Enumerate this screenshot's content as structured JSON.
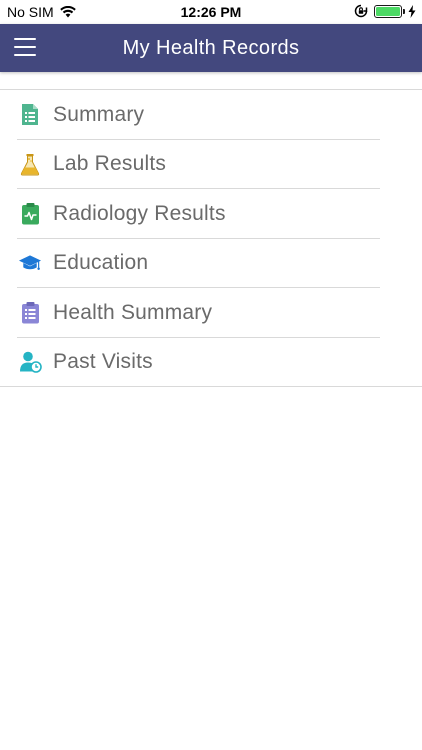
{
  "status": {
    "carrier": "No SIM",
    "time": "12:26 PM",
    "battery_color": "#4cd964"
  },
  "header": {
    "title": "My Health Records",
    "background": "#43487e"
  },
  "menu": {
    "items": [
      {
        "label": "Summary",
        "icon": "document-icon",
        "color": "#4fb58f"
      },
      {
        "label": "Lab Results",
        "icon": "flask-icon",
        "color": "#e8b52c"
      },
      {
        "label": "Radiology Results",
        "icon": "clipboard-pulse-icon",
        "color": "#3aaa5d"
      },
      {
        "label": "Education",
        "icon": "graduation-cap-icon",
        "color": "#1e78d6"
      },
      {
        "label": "Health Summary",
        "icon": "clipboard-list-icon",
        "color": "#8a86d6"
      },
      {
        "label": "Past Visits",
        "icon": "user-clock-icon",
        "color": "#25b4c4"
      }
    ]
  }
}
